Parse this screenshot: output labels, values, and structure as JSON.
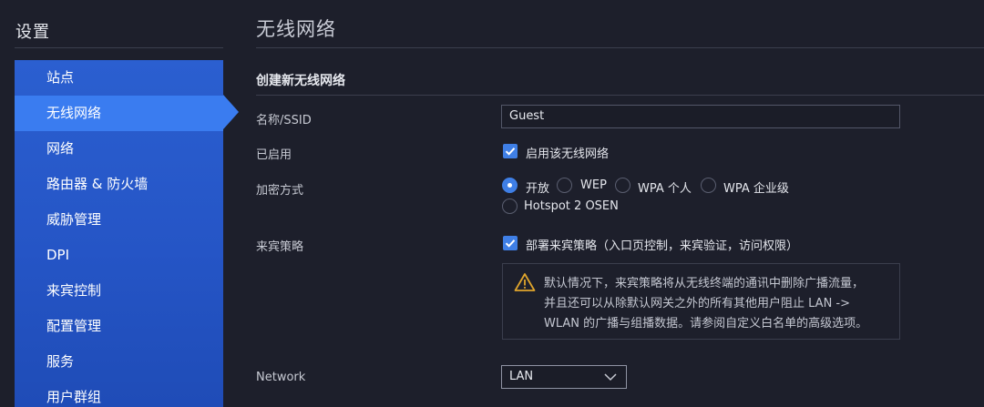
{
  "sidebar": {
    "title": "设置",
    "items": [
      {
        "label": "站点"
      },
      {
        "label": "无线网络"
      },
      {
        "label": "网络"
      },
      {
        "label": "路由器 & 防火墙"
      },
      {
        "label": "威胁管理"
      },
      {
        "label": "DPI"
      },
      {
        "label": "来宾控制"
      },
      {
        "label": "配置管理"
      },
      {
        "label": "服务"
      },
      {
        "label": "用户群组"
      }
    ],
    "active_index": 1
  },
  "main": {
    "page_title": "无线网络",
    "section_title": "创建新无线网络",
    "fields": {
      "ssid": {
        "label": "名称/SSID",
        "value": "Guest"
      },
      "enabled": {
        "label": "已启用",
        "checkbox_label": "启用该无线网络",
        "checked": true
      },
      "security": {
        "label": "加密方式",
        "options": [
          "开放",
          "WEP",
          "WPA 个人",
          "WPA 企业级",
          "Hotspot 2 OSEN"
        ],
        "selected": "开放"
      },
      "guest_policy": {
        "label": "来宾策略",
        "checkbox_label": "部署来宾策略（入口页控制，来宾验证，访问权限）",
        "checked": true,
        "warning_lines": [
          "默认情况下，来宾策略将从无线终端的通讯中删除广播流量，",
          "并且还可以从除默认网关之外的所有其他用户阻止 LAN ->",
          "WLAN 的广播与组播数据。请参阅自定义白名单的高级选项。"
        ]
      },
      "network": {
        "label": "Network",
        "value": "LAN"
      }
    }
  },
  "colors": {
    "accent": "#3f7fe6",
    "sidebar": "#2555c6",
    "sidebar_active": "#3a7cf0",
    "background": "#1d1f2b",
    "warning": "#e0a52c"
  },
  "icons": {
    "warning": "warning-triangle-icon",
    "check": "checkmark-icon",
    "dropdown": "chevron-down-icon"
  }
}
